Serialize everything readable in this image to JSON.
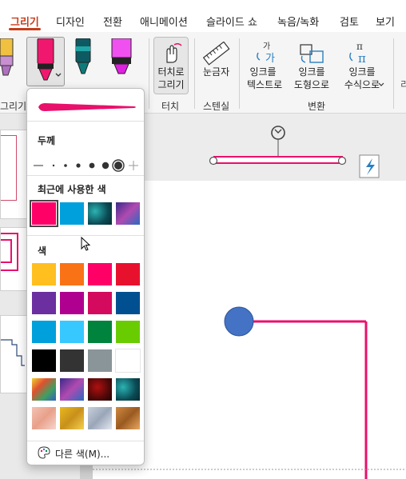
{
  "tabs": [
    {
      "label": "그리기",
      "active": true
    },
    {
      "label": "디자인"
    },
    {
      "label": "전환"
    },
    {
      "label": "애니메이션"
    },
    {
      "label": "슬라이드 쇼"
    },
    {
      "label": "녹음/녹화"
    },
    {
      "label": "검토"
    },
    {
      "label": "보기"
    }
  ],
  "ribbon": {
    "groups": {
      "draw": "그리기",
      "touch": "터치",
      "stencil": "스텐실",
      "convert": "변환"
    },
    "touch_button": "터치로\n그리기",
    "ruler_button": "눈금자",
    "ink_to_text": "잉크를\n텍스트로",
    "ink_to_shape": "잉크를\n도형으로",
    "ink_to_math": "잉크를\n수식으로"
  },
  "dropdown": {
    "thickness_label": "두께",
    "recent_label": "최근에 사용한 색",
    "colors_label": "색",
    "more_colors": "다른 색(M)...",
    "selected_color": "#ff0066",
    "recent_colors": [
      {
        "name": "pink",
        "color": "#ff0066"
      },
      {
        "name": "blue",
        "color": "#00a0dc"
      },
      {
        "name": "teal-texture",
        "color": "#0f6e6e"
      },
      {
        "name": "galaxy-texture",
        "color": "#6b3fa0"
      }
    ],
    "colors": [
      [
        "#ffbf1f",
        "#f97316",
        "#ff0066",
        "#e8112d"
      ],
      [
        "#6b2fa0",
        "#b0008f",
        "#d40a5e",
        "#004f91"
      ],
      [
        "#00a0dc",
        "#37c8ff",
        "#00843d",
        "#69cc00"
      ],
      [
        "#000000",
        "#333333",
        "#8a9599",
        "#ffffff"
      ],
      [
        "rainbow-texture",
        "galaxy-texture",
        "lava-texture",
        "ocean-texture"
      ],
      [
        "rose-gold-texture",
        "gold-texture",
        "silver-texture",
        "bronze-texture"
      ]
    ]
  },
  "colors": {
    "accent": "#c43e1c",
    "ink": "#e8106b",
    "shape_blue": "#4472c4"
  }
}
